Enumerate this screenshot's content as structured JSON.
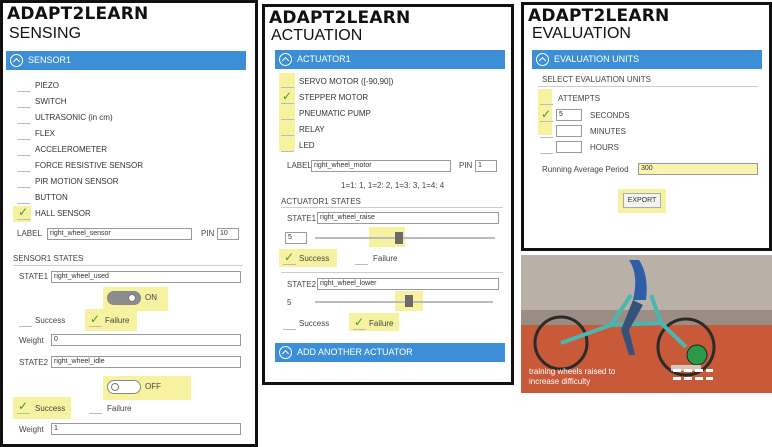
{
  "brand": "ADAPT2LEARN",
  "sensing": {
    "title": "SENSING",
    "bar_label": "SENSOR1",
    "sensors": [
      {
        "label": "PIEZO",
        "checked": false
      },
      {
        "label": "SWITCH",
        "checked": false
      },
      {
        "label": "ULTRASONIC (in cm)",
        "checked": false
      },
      {
        "label": "FLEX",
        "checked": false
      },
      {
        "label": "ACCELEROMETER",
        "checked": false
      },
      {
        "label": "FORCE RESISTIVE SENSOR",
        "checked": false
      },
      {
        "label": "PIR MOTION SENSOR",
        "checked": false
      },
      {
        "label": "BUTTON",
        "checked": false
      },
      {
        "label": "HALL SENSOR",
        "checked": true
      }
    ],
    "label_caption": "LABEL",
    "label_value": "right_wheel_sensor",
    "pin_caption": "PIN",
    "pin_value": "10",
    "states_heading": "SENSOR1 STATES",
    "state1_caption": "STATE1",
    "state1_value": "right_wheel_used",
    "toggle1_text": "ON",
    "success_label": "Success",
    "failure_label": "Failure",
    "weight_caption": "Weight",
    "weight1_value": "0",
    "state2_caption": "STATE2",
    "state2_value": "right_wheel_idle",
    "toggle2_text": "OFF",
    "weight2_value": "1"
  },
  "actuation": {
    "title": "ACTUATION",
    "bar_label": "ACTUATOR1",
    "actuators": [
      {
        "label": "SERVO MOTOR ([-90,90])",
        "checked": false
      },
      {
        "label": "STEPPER MOTOR",
        "checked": true
      },
      {
        "label": "PNEUMATIC PUMP",
        "checked": false
      },
      {
        "label": "RELAY",
        "checked": false
      },
      {
        "label": "LED",
        "checked": false
      }
    ],
    "label_caption": "LABEL",
    "label_value": "right_wheel_motor",
    "pin_caption": "PIN",
    "pin_value": "1",
    "steps_text": "1=1: 1, 1=2: 2, 1=3: 3, 1=4: 4",
    "states_heading": "ACTUATOR1 STATES",
    "state1_caption": "STATE1",
    "state1_value": "right_wheel_raise",
    "state1_num": "5",
    "state2_caption": "STATE2",
    "state2_value": "right_wheel_lower",
    "state2_num": "5",
    "success_label": "Success",
    "failure_label": "Failure",
    "add_label": "ADD ANOTHER ACTUATOR"
  },
  "evaluation": {
    "title": "EVALUATION",
    "bar_label": "EVALUATION UNITS",
    "select_heading": "SELECT EVALUATION UNITS",
    "attempts_label": "ATTEMPTS",
    "units": [
      {
        "value": "5",
        "label": "SECONDS",
        "checked": true
      },
      {
        "value": "",
        "label": "MINUTES",
        "checked": false
      },
      {
        "value": "",
        "label": "HOURS",
        "checked": false
      }
    ],
    "running_label": "Running Average Period",
    "running_value": "300",
    "export_label": "EXPORT"
  },
  "photo": {
    "caption_line1": "training wheels raised to",
    "caption_line2": "increase difficulty"
  },
  "colors": {
    "bar_blue": "#3c8fd6",
    "highlight": "#f7f2a0",
    "check_green": "#4a9a2a"
  }
}
